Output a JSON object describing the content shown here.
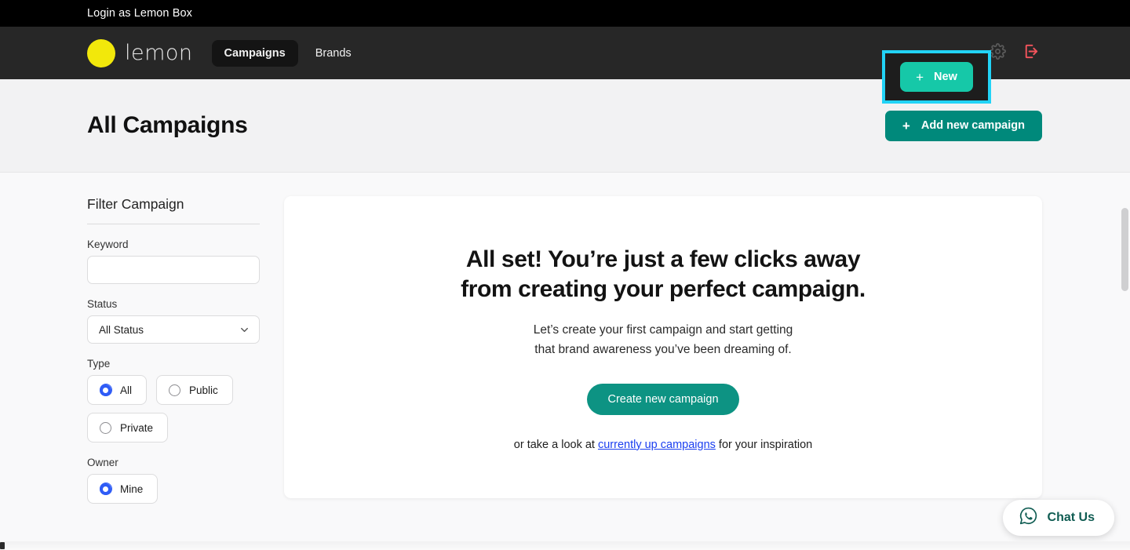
{
  "impersonation": {
    "label": "Login as Lemon Box"
  },
  "navbar": {
    "brand_name": "lemon",
    "brand_icon": "lemon-circle-logo",
    "links": [
      {
        "label": "Campaigns",
        "active": true
      },
      {
        "label": "Brands",
        "active": false
      }
    ],
    "new_button": {
      "label": "New",
      "plus": "+",
      "highlight_color": "#22d3f7",
      "background_color": "#16c8a8"
    },
    "settings_icon": "gear-icon",
    "logout_icon": "logout-icon",
    "logout_icon_color": "#f4545c",
    "background_color": "#272727"
  },
  "page_header": {
    "title": "All Campaigns",
    "add_button": {
      "label": "Add new campaign",
      "plus": "+",
      "background_color": "#00897b"
    }
  },
  "filter_panel": {
    "heading": "Filter Campaign",
    "keyword": {
      "label": "Keyword",
      "value": "",
      "placeholder": ""
    },
    "status": {
      "label": "Status",
      "selected": "All Status",
      "chevron_icon": "chevron-down-icon"
    },
    "type": {
      "label": "Type",
      "options": [
        {
          "label": "All",
          "checked": true
        },
        {
          "label": "Public",
          "checked": false
        },
        {
          "label": "Private",
          "checked": false
        }
      ]
    },
    "owner": {
      "label": "Owner",
      "options": [
        {
          "label": "Mine",
          "checked": true
        }
      ]
    },
    "radio_accent_color": "#2f5cf6"
  },
  "empty_state": {
    "title_line1": "All set! You’re just a few clicks away",
    "title_line2": "from creating your perfect campaign.",
    "subtitle_line1": "Let’s create your first campaign and start getting",
    "subtitle_line2": "that brand awareness you’ve been dreaming of.",
    "cta_label": "Create new campaign",
    "cta_color": "#0d9383",
    "footer_prefix": "or take a look at ",
    "footer_link": "currently up campaigns",
    "footer_suffix": " for your inspiration",
    "footer_link_color": "#1a3ef0"
  },
  "chat_widget": {
    "label": "Chat Us",
    "icon": "whatsapp-icon",
    "color": "#0f5c52"
  }
}
